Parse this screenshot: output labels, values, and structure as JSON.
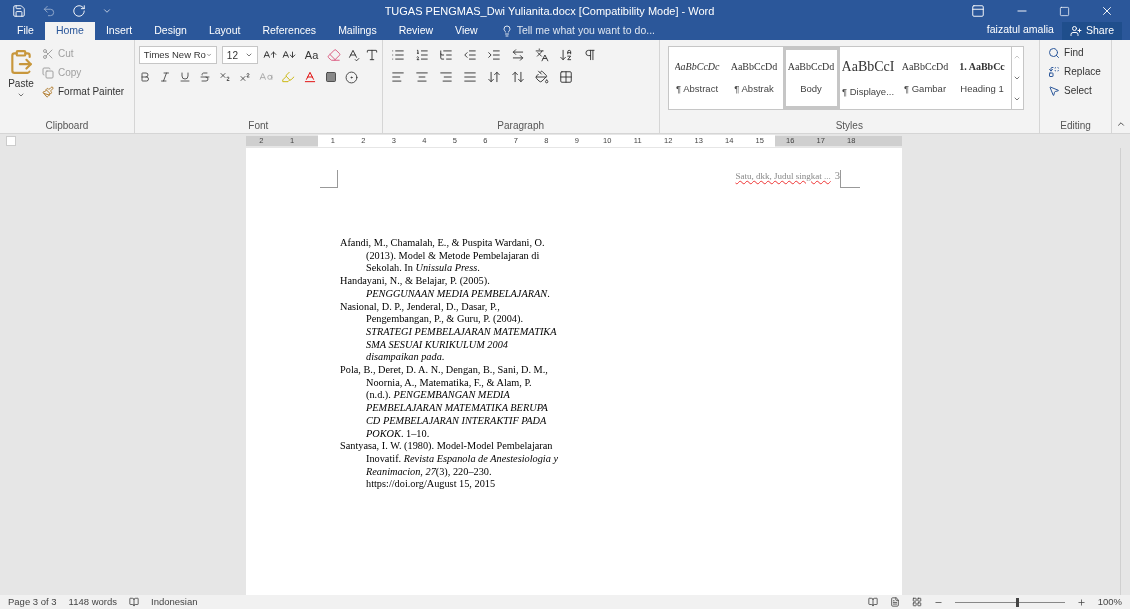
{
  "window": {
    "title": "TUGAS PENGMAS_Dwi Yulianita.docx [Compatibility Mode] - Word"
  },
  "tabs": [
    {
      "label": "File",
      "selected": false
    },
    {
      "label": "Home",
      "selected": true
    },
    {
      "label": "Insert",
      "selected": false
    },
    {
      "label": "Design",
      "selected": false
    },
    {
      "label": "Layout",
      "selected": false
    },
    {
      "label": "References",
      "selected": false
    },
    {
      "label": "Mailings",
      "selected": false
    },
    {
      "label": "Review",
      "selected": false
    },
    {
      "label": "View",
      "selected": false
    }
  ],
  "tell_me": {
    "placeholder": "Tell me what you want to do..."
  },
  "user": "faizatul amalia",
  "share": "Share",
  "clipboard": {
    "paste": "Paste",
    "cut": {
      "label": "Cut",
      "disabled": true
    },
    "copy": {
      "label": "Copy",
      "disabled": true
    },
    "format_painter": "Format Painter",
    "label": "Clipboard"
  },
  "font": {
    "font_name": "Times New Ro",
    "font_size": "12",
    "change_case": "Aa",
    "label": "Font"
  },
  "paragraph": {
    "label": "Paragraph"
  },
  "styles": {
    "label": "Styles",
    "items": [
      {
        "preview": "AaBbCcDc",
        "name": "¶ Abstract",
        "kind": "italic",
        "selected": false
      },
      {
        "preview": "AaBbCcDd",
        "name": "¶ Abstrak",
        "kind": "normal",
        "selected": false
      },
      {
        "preview": "AaBbCcDd",
        "name": "Body",
        "kind": "normal",
        "selected": true
      },
      {
        "preview": "AaBbCcI",
        "name": "¶ Displaye...",
        "kind": "large",
        "selected": false
      },
      {
        "preview": "AaBbCcDd",
        "name": "¶ Gambar",
        "kind": "normal",
        "selected": false
      },
      {
        "preview": "1.  AaBbCc",
        "name": "Heading 1",
        "kind": "bold",
        "selected": false
      }
    ]
  },
  "editing": {
    "find": "Find",
    "replace": "Replace",
    "select": "Select",
    "label": "Editing"
  },
  "ruler": {
    "numbers": [
      "2",
      "1",
      "1",
      "2",
      "3",
      "4",
      "5",
      "6",
      "7",
      "8",
      "9",
      "10",
      "11",
      "12",
      "13",
      "14",
      "15",
      "16",
      "17",
      "18"
    ]
  },
  "document": {
    "header": "Satu, dkk, Judul singkat ...",
    "page_number": "3",
    "references": [
      {
        "lines": [
          "Afandi, M., Chamalah, E., & Puspita Wardani, O.",
          "(2013). Model & Metode Pembelajaran di",
          "Sekolah. In *Unissula Press*."
        ]
      },
      {
        "lines": [
          "Handayani, N., & Belajar, P. (2005).",
          "*PENGGUNAAN MEDIA PEMBELAJARAN*."
        ]
      },
      {
        "lines": [
          "Nasional, D. P., Jenderal, D., Dasar, P.,",
          "Pengembangan, P., & Guru, P. (2004).",
          "*STRATEGI PEMBELAJARAN MATEMATIKA*",
          "*SMA SESUAI KURIKULUM 2004*",
          "*disampaikan pada*."
        ]
      },
      {
        "lines": [
          "Pola, B., Deret, D. A. N., Dengan, B., Sani, D. M.,",
          "Noornia, A., Matematika, F., & Alam, P.",
          "(n.d.). *PENGEMBANGAN MEDIA*",
          "*PEMBELAJARAN MATEMATIKA BERUPA*",
          "*CD PEMBELAJARAN INTERAKTIF PADA*",
          "*POKOK*. 1–10."
        ]
      },
      {
        "lines": [
          "Santyasa, I. W. (1980). Model-Model Pembelajaran",
          "Inovatif. *Revista Espanola de Anestesiologia y*",
          "*Reanimacion*, *27*(3), 220–230.",
          "https://doi.org/August 15, 2015"
        ]
      }
    ]
  },
  "status_bar": {
    "page": "Page 3 of 3",
    "words": "1148 words",
    "language": "Indonesian",
    "zoom": {
      "level": 0.56,
      "reading": "100%"
    }
  }
}
